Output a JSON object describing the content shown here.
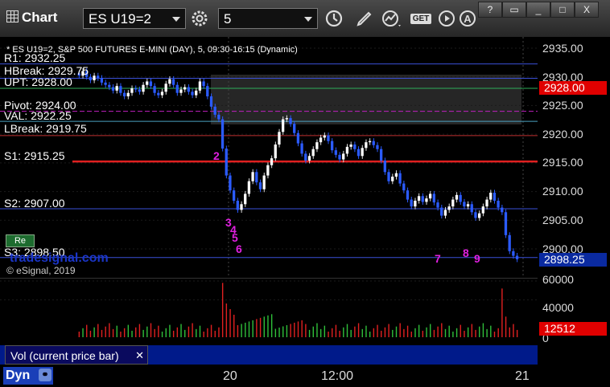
{
  "app": {
    "title": "Chart"
  },
  "toolbar": {
    "symbol": "ES U19=2",
    "interval": "5",
    "get_label": "GET",
    "a_label": "A"
  },
  "window_buttons": [
    "?",
    "▭",
    "_",
    "□",
    "X"
  ],
  "chart": {
    "header": "* ES U19=2, S&P 500 FUTURES E-MINI (DAY), 5, 09:30-16:15 (Dynamic)",
    "copyright": "© eSignal, 2019",
    "watermark": "tradesignal.com",
    "re_button": "Re",
    "levels": [
      {
        "label": "R1: 2932.25",
        "price": 2932.25,
        "color": "#3a50d8"
      },
      {
        "label": "HBreak: 2929.75",
        "price": 2929.75,
        "color": "#3a50d8"
      },
      {
        "label": "UPT: 2928.00",
        "price": 2928.0,
        "color": "#2fae5a"
      },
      {
        "label": "Pivot: 2924.00",
        "price": 2924.0,
        "color": "#c020c0"
      },
      {
        "label": "VAL: 2922.25",
        "price": 2922.25,
        "color": "#4aa0c0"
      },
      {
        "label": "LBreak: 2919.75",
        "price": 2919.75,
        "color": "#c03030"
      },
      {
        "label": "S1: 2915.25",
        "price": 2915.25,
        "color": "#e02020"
      },
      {
        "label": "S2: 2907.00",
        "price": 2907.0,
        "color": "#3a50d8"
      },
      {
        "label": "S3: 2898.50",
        "price": 2898.5,
        "color": "#3a50d8"
      }
    ],
    "y_ticks": [
      "2935.00",
      "2930.00",
      "2925.00",
      "2920.00",
      "2915.00",
      "2910.00",
      "2905.00",
      "2900.00"
    ],
    "vol_ticks": [
      "60000",
      "40000",
      "0"
    ],
    "price_badges": [
      {
        "label": "2928.00",
        "color": "#e00000"
      },
      {
        "label": "2898.25",
        "color": "#0a2aa0"
      }
    ],
    "volume_badge": "12512",
    "volume_badge_color": "#e00000",
    "x_ticks": [
      "20",
      "12:00",
      "21"
    ],
    "counts": [
      {
        "text": "2",
        "color": "#e020e0"
      },
      {
        "text": "3",
        "color": "#e020e0"
      },
      {
        "text": "4",
        "color": "#e020e0"
      },
      {
        "text": "5",
        "color": "#e020e0"
      },
      {
        "text": "6",
        "color": "#e020e0"
      },
      {
        "text": "7",
        "color": "#e020e0"
      },
      {
        "text": "8",
        "color": "#e020e0"
      },
      {
        "text": "9",
        "color": "#e020e0"
      }
    ]
  },
  "study_tab": "Vol (current price bar)",
  "bottom": {
    "dyn_label": "Dyn"
  }
}
